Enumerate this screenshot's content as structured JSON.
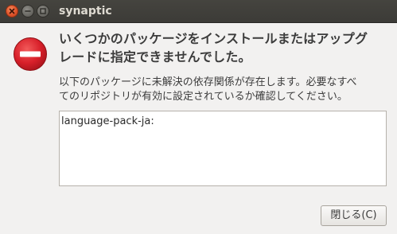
{
  "window": {
    "title": "synaptic"
  },
  "dialog": {
    "headline_line1": "いくつかのパッケージをインストールまたはアップグ",
    "headline_line2": "レードに指定できませんでした。",
    "message_line1": "以下のパッケージに未解決の依存関係が存在します。必要なすべ",
    "message_line2": "てのリポジトリが有効に設定されているか確認してください。",
    "details": "language-pack-ja:",
    "close_label": "閉じる(C)",
    "icon": "error-icon"
  },
  "colors": {
    "titlebar": "#3c3b37",
    "close_button": "#e0532a",
    "error_icon": "#d8202a",
    "background": "#f2f1f0"
  }
}
